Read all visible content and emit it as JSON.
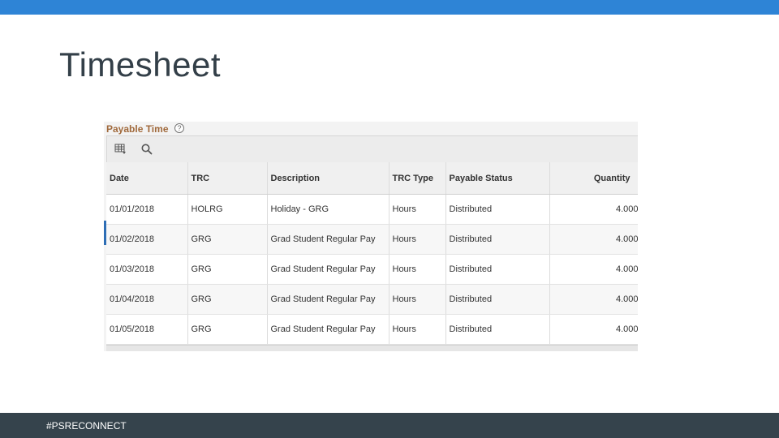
{
  "slide": {
    "title": "Timesheet",
    "footer": "#PSRECONNECT"
  },
  "panel": {
    "title": "Payable Time",
    "help_glyph": "?"
  },
  "toolbar": {
    "icons": [
      "grid-personalize-icon",
      "search-icon"
    ]
  },
  "table": {
    "headers": [
      "Date",
      "TRC",
      "Description",
      "TRC Type",
      "Payable Status",
      "Quantity"
    ],
    "rows": [
      [
        "01/01/2018",
        "HOLRG",
        "Holiday - GRG",
        "Hours",
        "Distributed",
        "4.000"
      ],
      [
        "01/02/2018",
        "GRG",
        "Grad Student Regular Pay",
        "Hours",
        "Distributed",
        "4.000"
      ],
      [
        "01/03/2018",
        "GRG",
        "Grad Student Regular Pay",
        "Hours",
        "Distributed",
        "4.000"
      ],
      [
        "01/04/2018",
        "GRG",
        "Grad Student Regular Pay",
        "Hours",
        "Distributed",
        "4.000"
      ],
      [
        "01/05/2018",
        "GRG",
        "Grad Student Regular Pay",
        "Hours",
        "Distributed",
        "4.000"
      ]
    ]
  },
  "colors": {
    "accent_bar": "#2e84d6",
    "footer_bg": "#35434c",
    "panel_title": "#a0693b"
  }
}
